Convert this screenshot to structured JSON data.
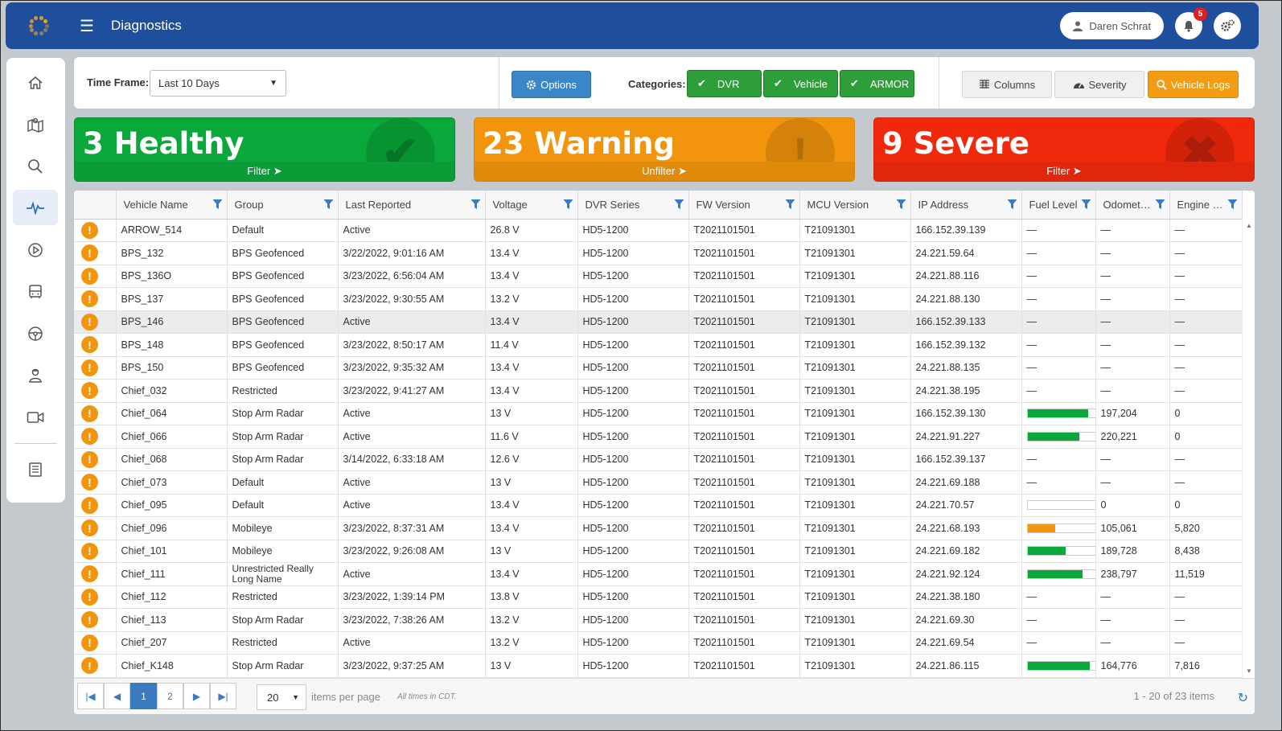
{
  "app": {
    "title": "Diagnostics"
  },
  "header": {
    "user_name": "Daren Schrat",
    "notifications_count": "5"
  },
  "sidebar": {
    "items": [
      {
        "icon": "home-icon"
      },
      {
        "icon": "map-icon"
      },
      {
        "icon": "search-icon"
      },
      {
        "icon": "pulse-icon",
        "active": true
      },
      {
        "icon": "play-icon"
      },
      {
        "icon": "bus-icon"
      },
      {
        "icon": "steering-wheel-icon"
      },
      {
        "icon": "driver-icon"
      },
      {
        "icon": "video-camera-icon"
      },
      {
        "icon": "report-icon"
      }
    ]
  },
  "toolbar": {
    "timeframe_label": "Time Frame:",
    "timeframe_value": "Last 10 Days",
    "options_label": "Options",
    "categories_label": "Categories:",
    "categories": [
      "DVR",
      "Vehicle",
      "ARMOR"
    ],
    "columns_label": "Columns",
    "severity_label": "Severity",
    "vehicle_logs_label": "Vehicle Logs"
  },
  "status_cards": {
    "healthy": {
      "label": "3 Healthy",
      "action": "Filter"
    },
    "warning": {
      "label": "23 Warning",
      "action": "Unfilter"
    },
    "severe": {
      "label": "9 Severe",
      "action": "Filter"
    }
  },
  "colors": {
    "healthy": "#0aa83a",
    "warning": "#f2950c",
    "severe": "#f0280c",
    "brand": "#1f4e9c",
    "fuel_good": "#0aa83a",
    "fuel_low": "#f2950c"
  },
  "table": {
    "columns": [
      "Vehicle Name",
      "Group",
      "Last Reported",
      "Voltage",
      "DVR Series",
      "FW Version",
      "MCU Version",
      "IP Address",
      "Fuel Level",
      "Odomet…",
      "Engine …"
    ],
    "rows": [
      {
        "name": "ARROW_514",
        "group": "Default",
        "last": "Active",
        "volt": "26.8 V",
        "dvr": "HD5-1200",
        "fw": "T2021101501",
        "mcu": "T21091301",
        "ip": "166.152.39.139",
        "fuel": null,
        "odo": "—",
        "eng": "—"
      },
      {
        "name": "BPS_132",
        "group": "BPS Geofenced",
        "last": "3/22/2022, 9:01:16 AM",
        "volt": "13.4 V",
        "dvr": "HD5-1200",
        "fw": "T2021101501",
        "mcu": "T21091301",
        "ip": "24.221.59.64",
        "fuel": null,
        "odo": "—",
        "eng": "—"
      },
      {
        "name": "BPS_136O",
        "group": "BPS Geofenced",
        "last": "3/23/2022, 6:56:04 AM",
        "volt": "13.4 V",
        "dvr": "HD5-1200",
        "fw": "T2021101501",
        "mcu": "T21091301",
        "ip": "24.221.88.116",
        "fuel": null,
        "odo": "—",
        "eng": "—"
      },
      {
        "name": "BPS_137",
        "group": "BPS Geofenced",
        "last": "3/23/2022, 9:30:55 AM",
        "volt": "13.2 V",
        "dvr": "HD5-1200",
        "fw": "T2021101501",
        "mcu": "T21091301",
        "ip": "24.221.88.130",
        "fuel": null,
        "odo": "—",
        "eng": "—"
      },
      {
        "name": "BPS_146",
        "group": "BPS Geofenced",
        "last": "Active",
        "volt": "13.4 V",
        "dvr": "HD5-1200",
        "fw": "T2021101501",
        "mcu": "T21091301",
        "ip": "166.152.39.133",
        "fuel": null,
        "odo": "—",
        "eng": "—",
        "highlight": true
      },
      {
        "name": "BPS_148",
        "group": "BPS Geofenced",
        "last": "3/23/2022, 8:50:17 AM",
        "volt": "11.4 V",
        "dvr": "HD5-1200",
        "fw": "T2021101501",
        "mcu": "T21091301",
        "ip": "166.152.39.132",
        "fuel": null,
        "odo": "—",
        "eng": "—"
      },
      {
        "name": "BPS_150",
        "group": "BPS Geofenced",
        "last": "3/23/2022, 9:35:32 AM",
        "volt": "13.4 V",
        "dvr": "HD5-1200",
        "fw": "T2021101501",
        "mcu": "T21091301",
        "ip": "24.221.88.135",
        "fuel": null,
        "odo": "—",
        "eng": "—"
      },
      {
        "name": "Chief_032",
        "group": "Restricted",
        "last": "3/23/2022, 9:41:27 AM",
        "volt": "13.4 V",
        "dvr": "HD5-1200",
        "fw": "T2021101501",
        "mcu": "T21091301",
        "ip": "24.221.38.195",
        "fuel": null,
        "odo": "—",
        "eng": "—"
      },
      {
        "name": "Chief_064",
        "group": "Stop Arm Radar",
        "last": "Active",
        "volt": "13 V",
        "dvr": "HD5-1200",
        "fw": "T2021101501",
        "mcu": "T21091301",
        "ip": "166.152.39.130",
        "fuel": 0.88,
        "fuel_color": "#0aa83a",
        "odo": "197,204",
        "eng": "0"
      },
      {
        "name": "Chief_066",
        "group": "Stop Arm Radar",
        "last": "Active",
        "volt": "11.6 V",
        "dvr": "HD5-1200",
        "fw": "T2021101501",
        "mcu": "T21091301",
        "ip": "24.221.91.227",
        "fuel": 0.75,
        "fuel_color": "#0aa83a",
        "odo": "220,221",
        "eng": "0"
      },
      {
        "name": "Chief_068",
        "group": "Stop Arm Radar",
        "last": "3/14/2022, 6:33:18 AM",
        "volt": "12.6 V",
        "dvr": "HD5-1200",
        "fw": "T2021101501",
        "mcu": "T21091301",
        "ip": "166.152.39.137",
        "fuel": null,
        "odo": "—",
        "eng": "—"
      },
      {
        "name": "Chief_073",
        "group": "Default",
        "last": "Active",
        "volt": "13 V",
        "dvr": "HD5-1200",
        "fw": "T2021101501",
        "mcu": "T21091301",
        "ip": "24.221.69.188",
        "fuel": null,
        "odo": "—",
        "eng": "—"
      },
      {
        "name": "Chief_095",
        "group": "Default",
        "last": "Active",
        "volt": "13.4 V",
        "dvr": "HD5-1200",
        "fw": "T2021101501",
        "mcu": "T21091301",
        "ip": "24.221.70.57",
        "fuel": 0,
        "fuel_color": "#0aa83a",
        "odo": "0",
        "eng": "0"
      },
      {
        "name": "Chief_096",
        "group": "Mobileye",
        "last": "3/23/2022, 8:37:31 AM",
        "volt": "13.4 V",
        "dvr": "HD5-1200",
        "fw": "T2021101501",
        "mcu": "T21091301",
        "ip": "24.221.68.193",
        "fuel": 0.4,
        "fuel_color": "#f2950c",
        "odo": "105,061",
        "eng": "5,820"
      },
      {
        "name": "Chief_101",
        "group": "Mobileye",
        "last": "3/23/2022, 9:26:08 AM",
        "volt": "13 V",
        "dvr": "HD5-1200",
        "fw": "T2021101501",
        "mcu": "T21091301",
        "ip": "24.221.69.182",
        "fuel": 0.55,
        "fuel_color": "#0aa83a",
        "odo": "189,728",
        "eng": "8,438"
      },
      {
        "name": "Chief_111",
        "group": "Unrestricted Really Long Name",
        "last": "Active",
        "volt": "13.4 V",
        "dvr": "HD5-1200",
        "fw": "T2021101501",
        "mcu": "T21091301",
        "ip": "24.221.92.124",
        "fuel": 0.8,
        "fuel_color": "#0aa83a",
        "odo": "238,797",
        "eng": "11,519"
      },
      {
        "name": "Chief_112",
        "group": "Restricted",
        "last": "3/23/2022, 1:39:14 PM",
        "volt": "13.8 V",
        "dvr": "HD5-1200",
        "fw": "T2021101501",
        "mcu": "T21091301",
        "ip": "24.221.38.180",
        "fuel": null,
        "odo": "—",
        "eng": "—"
      },
      {
        "name": "Chief_113",
        "group": "Stop Arm Radar",
        "last": "3/23/2022, 7:38:26 AM",
        "volt": "13.2 V",
        "dvr": "HD5-1200",
        "fw": "T2021101501",
        "mcu": "T21091301",
        "ip": "24.221.69.30",
        "fuel": null,
        "odo": "—",
        "eng": "—"
      },
      {
        "name": "Chief_207",
        "group": "Restricted",
        "last": "Active",
        "volt": "13.2 V",
        "dvr": "HD5-1200",
        "fw": "T2021101501",
        "mcu": "T21091301",
        "ip": "24.221.69.54",
        "fuel": null,
        "odo": "—",
        "eng": "—"
      },
      {
        "name": "Chief_K148",
        "group": "Stop Arm Radar",
        "last": "3/23/2022, 9:37:25 AM",
        "volt": "13 V",
        "dvr": "HD5-1200",
        "fw": "T2021101501",
        "mcu": "T21091301",
        "ip": "24.221.86.115",
        "fuel": 0.9,
        "fuel_color": "#0aa83a",
        "odo": "164,776",
        "eng": "7,816"
      }
    ],
    "empty_value": "—",
    "severity_symbol": "!"
  },
  "pager": {
    "pages": [
      "1",
      "2"
    ],
    "current": "1",
    "page_size": "20",
    "items_per_page_label": "items per page",
    "timezone_note": "All times in CDT.",
    "range_text": "1 - 20 of 23 items"
  }
}
